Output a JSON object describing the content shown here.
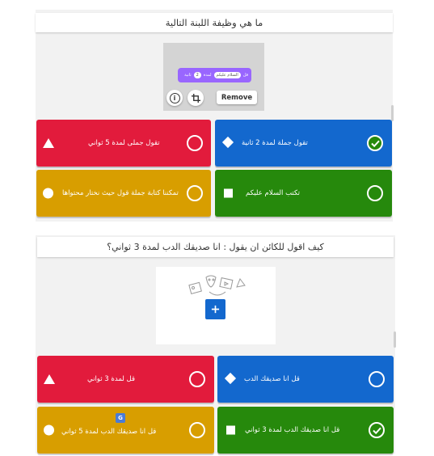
{
  "colors": {
    "red": "#e21b3c",
    "blue": "#1368ce",
    "yellow": "#d89e00",
    "green": "#26890c"
  },
  "q1": {
    "title": "ما هي وظيفة اللبنة التالية",
    "block": {
      "say": "قل",
      "text": "السلام عليكم",
      "for": "لمدة",
      "num": "2",
      "unit": "ثانية"
    },
    "remove_label": "Remove",
    "answers": [
      {
        "text": "تقول جملى لمدة 5 ثواني",
        "color": "red",
        "shape": "triangle",
        "correct": false
      },
      {
        "text": "تقول جملة لمدة 2 ثانية",
        "color": "blue",
        "shape": "diamond",
        "correct": true
      },
      {
        "text": "تمكننا كتابة جملة قول  حيث نختار محتواها",
        "color": "yellow",
        "shape": "circle",
        "correct": false
      },
      {
        "text": "تكتب  السلام عليكم",
        "color": "green",
        "shape": "square",
        "correct": false
      }
    ]
  },
  "q2": {
    "title": "كيف اقول للكائن ان يقول : انا صديقك الدب لمدة 3 ثواني؟",
    "add_media_icon": "plus-icon",
    "answers": [
      {
        "text": "قل لمدة 3 ثواني",
        "color": "red",
        "shape": "triangle",
        "correct": false
      },
      {
        "text": "قل انا صديقك الدب",
        "color": "blue",
        "shape": "diamond",
        "correct": false
      },
      {
        "text": "قل انا صديقك الدب لمدة 5 ثواني",
        "color": "yellow",
        "shape": "circle",
        "correct": false
      },
      {
        "text": "قل انا صديقك الدب لمدة 3 ثواني",
        "color": "green",
        "shape": "square",
        "correct": true
      }
    ]
  }
}
